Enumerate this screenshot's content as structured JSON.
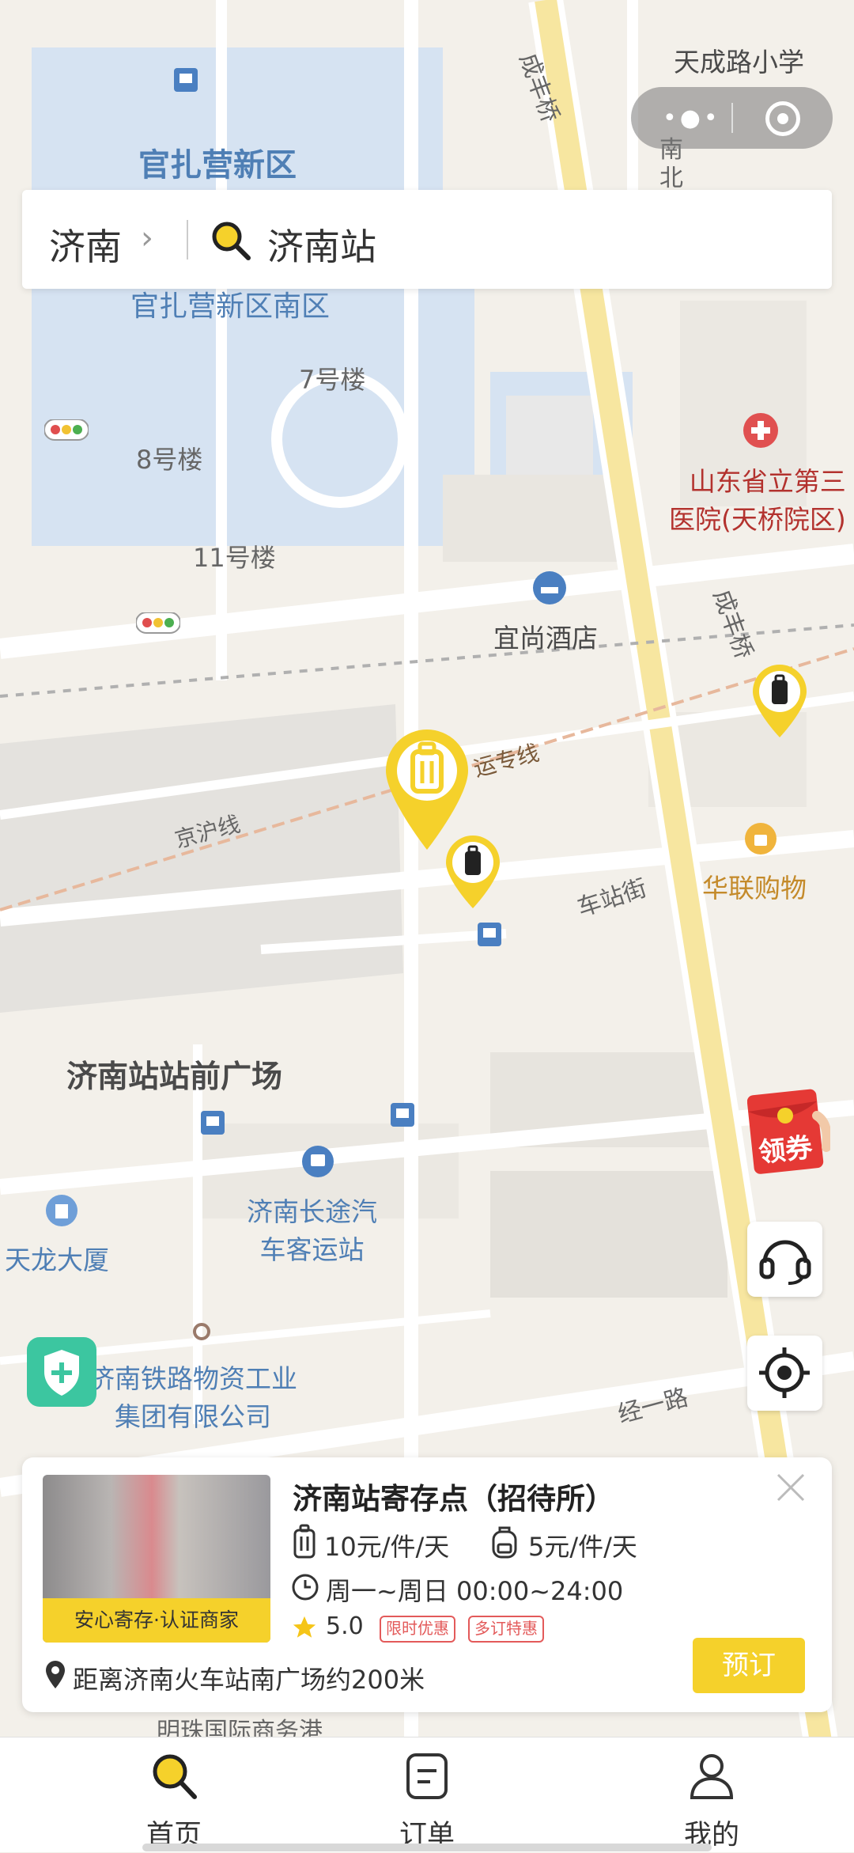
{
  "top_bar": {
    "city": "济南",
    "search_text": "济南站"
  },
  "map_labels": {
    "tiancheng_school": "天成路小学",
    "guanzhaying_new": "官扎营新区",
    "guanzhaying_south": "官扎营新区南区",
    "bld7": "7号楼",
    "bld8": "8号楼",
    "bld11": "11号楼",
    "hospital": "山东省立第三\n医院(天桥院区)",
    "chengfeng_bridge1": "成丰桥",
    "chengfeng_bridge2": "成丰桥",
    "south": "南",
    "north": "北",
    "yishang_hotel": "宜尚酒店",
    "yunzhuan_line": "运专线",
    "jinghu_line": "京沪线",
    "chezhan_street": "车站街",
    "hualian": "华联购物",
    "plaza": "济南站站前广场",
    "bus_station": "济南长途汽\n车客运站",
    "tianlong": "天龙大厦",
    "railway_group": "济南铁路物资工业\n集团有限公司",
    "jingyi_road": "经一路",
    "mingzhu": "明珠国际商务港"
  },
  "coupon_label": "领券",
  "store": {
    "name": "济南站寄存点（招待所）",
    "badge": "安心寄存·认证商家",
    "price_large": "10元/件/天",
    "price_small": "5元/件/天",
    "hours": "周一~周日 00:00~24:00",
    "rating": "5.0",
    "tags": [
      "限时优惠",
      "多订特惠"
    ],
    "distance": "距离济南火车站南广场约200米",
    "book_label": "预订"
  },
  "tabs": [
    {
      "label": "首页",
      "icon": "search-icon"
    },
    {
      "label": "订单",
      "icon": "order-icon"
    },
    {
      "label": "我的",
      "icon": "user-icon"
    }
  ],
  "colors": {
    "accent": "#f5d12b",
    "tag_red": "#e35a5a",
    "shield_green": "#3cc6a0"
  }
}
